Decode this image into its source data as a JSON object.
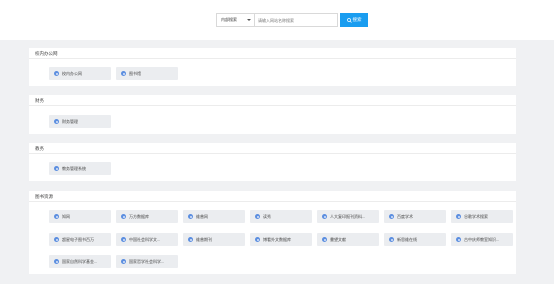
{
  "search": {
    "scope_value": "内部搜索",
    "placeholder": "请输入网站名称搜索",
    "button_label": "搜索"
  },
  "sections": [
    {
      "title": "校内办公网",
      "items": [
        "校内办公网",
        "图书馆"
      ]
    },
    {
      "title": "财务",
      "items": [
        "财务管理"
      ]
    },
    {
      "title": "教务",
      "items": [
        "教务管理系统"
      ]
    },
    {
      "title": "图书资源",
      "items": [
        "知网",
        "万方数据库",
        "维普网",
        "读秀",
        "人大复印报刊资料...",
        "百度学术",
        "谷歌学术搜索",
        "超星电子图书百万",
        "中国社会科学文...",
        "维普期刊",
        "博看外文数据库",
        "書望文献",
        "新思维在线",
        "古中庆师教室知识...",
        "国家自然科学基金...",
        "国家哲学社会科学..."
      ]
    }
  ],
  "colors": {
    "accent": "#1a9df0",
    "tile_bg": "#ebedf0",
    "icon": "#5b8ee0"
  }
}
